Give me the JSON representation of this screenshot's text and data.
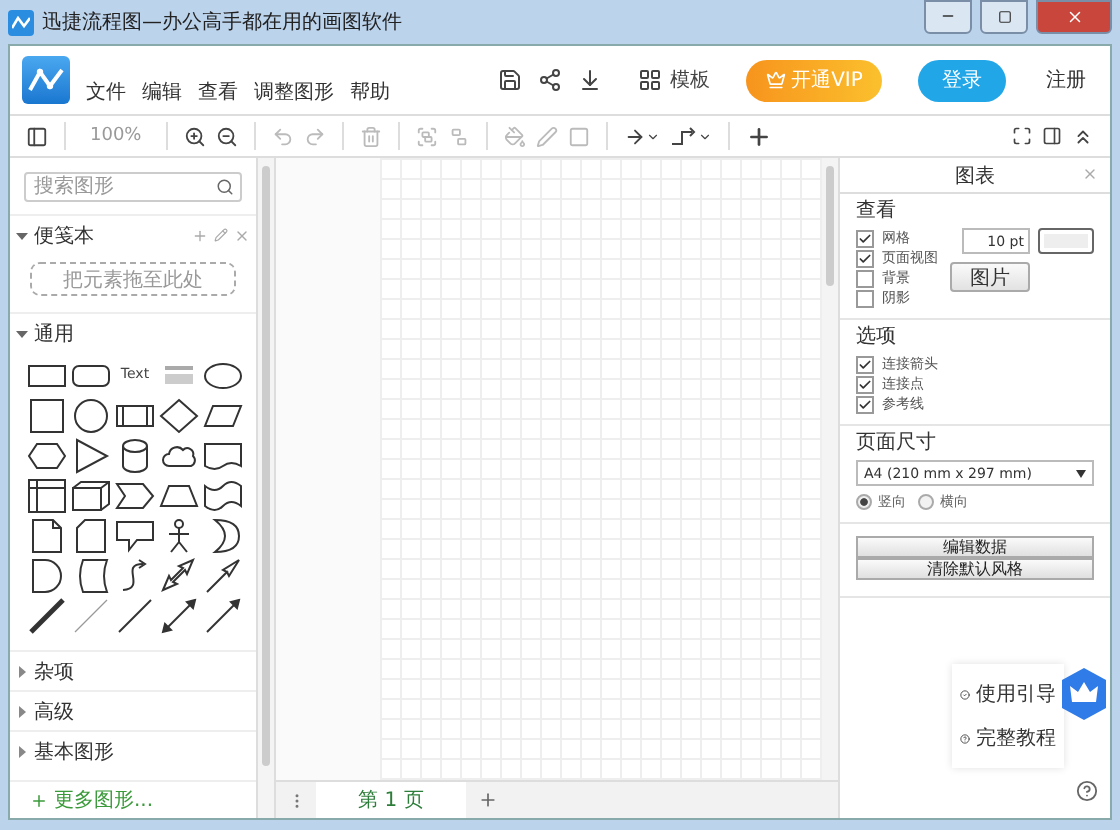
{
  "window": {
    "title": "迅捷流程图—办公高手都在用的画图软件"
  },
  "menu": [
    "文件",
    "编辑",
    "查看",
    "调整图形",
    "帮助"
  ],
  "header": {
    "templates": "模板",
    "vip": "开通VIP",
    "login": "登录",
    "register": "注册"
  },
  "toolbar": {
    "zoom": "100%"
  },
  "sidebar": {
    "search": {
      "placeholder": "搜索图形"
    },
    "scratchpad": {
      "title": "便笺本",
      "expanded": true,
      "drop_hint": "把元素拖至此处"
    },
    "general": {
      "title": "通用",
      "expanded": true
    },
    "shapes": [
      {
        "kind": "rect"
      },
      {
        "kind": "rounded"
      },
      {
        "kind": "text",
        "label": "Text"
      },
      {
        "kind": "textbox"
      },
      {
        "kind": "ellipse"
      },
      {
        "kind": "square"
      },
      {
        "kind": "circle"
      },
      {
        "kind": "process"
      },
      {
        "kind": "diamond"
      },
      {
        "kind": "parallelogram"
      },
      {
        "kind": "hexagon"
      },
      {
        "kind": "triangle"
      },
      {
        "kind": "cylinder"
      },
      {
        "kind": "cloud"
      },
      {
        "kind": "document"
      },
      {
        "kind": "storage"
      },
      {
        "kind": "cube"
      },
      {
        "kind": "step"
      },
      {
        "kind": "trapezoid"
      },
      {
        "kind": "tape"
      },
      {
        "kind": "note"
      },
      {
        "kind": "card"
      },
      {
        "kind": "callout"
      },
      {
        "kind": "actor"
      },
      {
        "kind": "or"
      },
      {
        "kind": "delay"
      },
      {
        "kind": "datastore"
      },
      {
        "kind": "curve"
      },
      {
        "kind": "doublearrow"
      },
      {
        "kind": "arrow"
      },
      {
        "kind": "thickline"
      },
      {
        "kind": "thinline"
      },
      {
        "kind": "line"
      },
      {
        "kind": "bidiline"
      },
      {
        "kind": "arrowline"
      }
    ],
    "sections": [
      {
        "title": "杂项",
        "expanded": false
      },
      {
        "title": "高级",
        "expanded": false
      },
      {
        "title": "基本图形",
        "expanded": false
      }
    ],
    "more": "更多图形..."
  },
  "pages": [
    {
      "label": "第 1 页",
      "selected": true
    }
  ],
  "panel": {
    "title": "图表",
    "view": {
      "heading": "查看",
      "options": [
        {
          "label": "网格",
          "checked": true
        },
        {
          "label": "页面视图",
          "checked": true
        },
        {
          "label": "背景",
          "checked": false
        },
        {
          "label": "阴影",
          "checked": false
        }
      ],
      "grid_size": "10 pt",
      "image_button": "图片"
    },
    "options": {
      "heading": "选项",
      "items": [
        {
          "label": "连接箭头",
          "checked": true
        },
        {
          "label": "连接点",
          "checked": true
        },
        {
          "label": "参考线",
          "checked": true
        }
      ]
    },
    "page_size": {
      "heading": "页面尺寸",
      "value": "A4 (210 mm x 297 mm)",
      "orientations": [
        {
          "label": "竖向",
          "selected": true
        },
        {
          "label": "横向",
          "selected": false
        }
      ]
    },
    "buttons": [
      "编辑数据",
      "清除默认风格"
    ]
  },
  "help": [
    {
      "kind": "guide",
      "label": "使用引导"
    },
    {
      "kind": "tutorial",
      "label": "完整教程"
    }
  ]
}
